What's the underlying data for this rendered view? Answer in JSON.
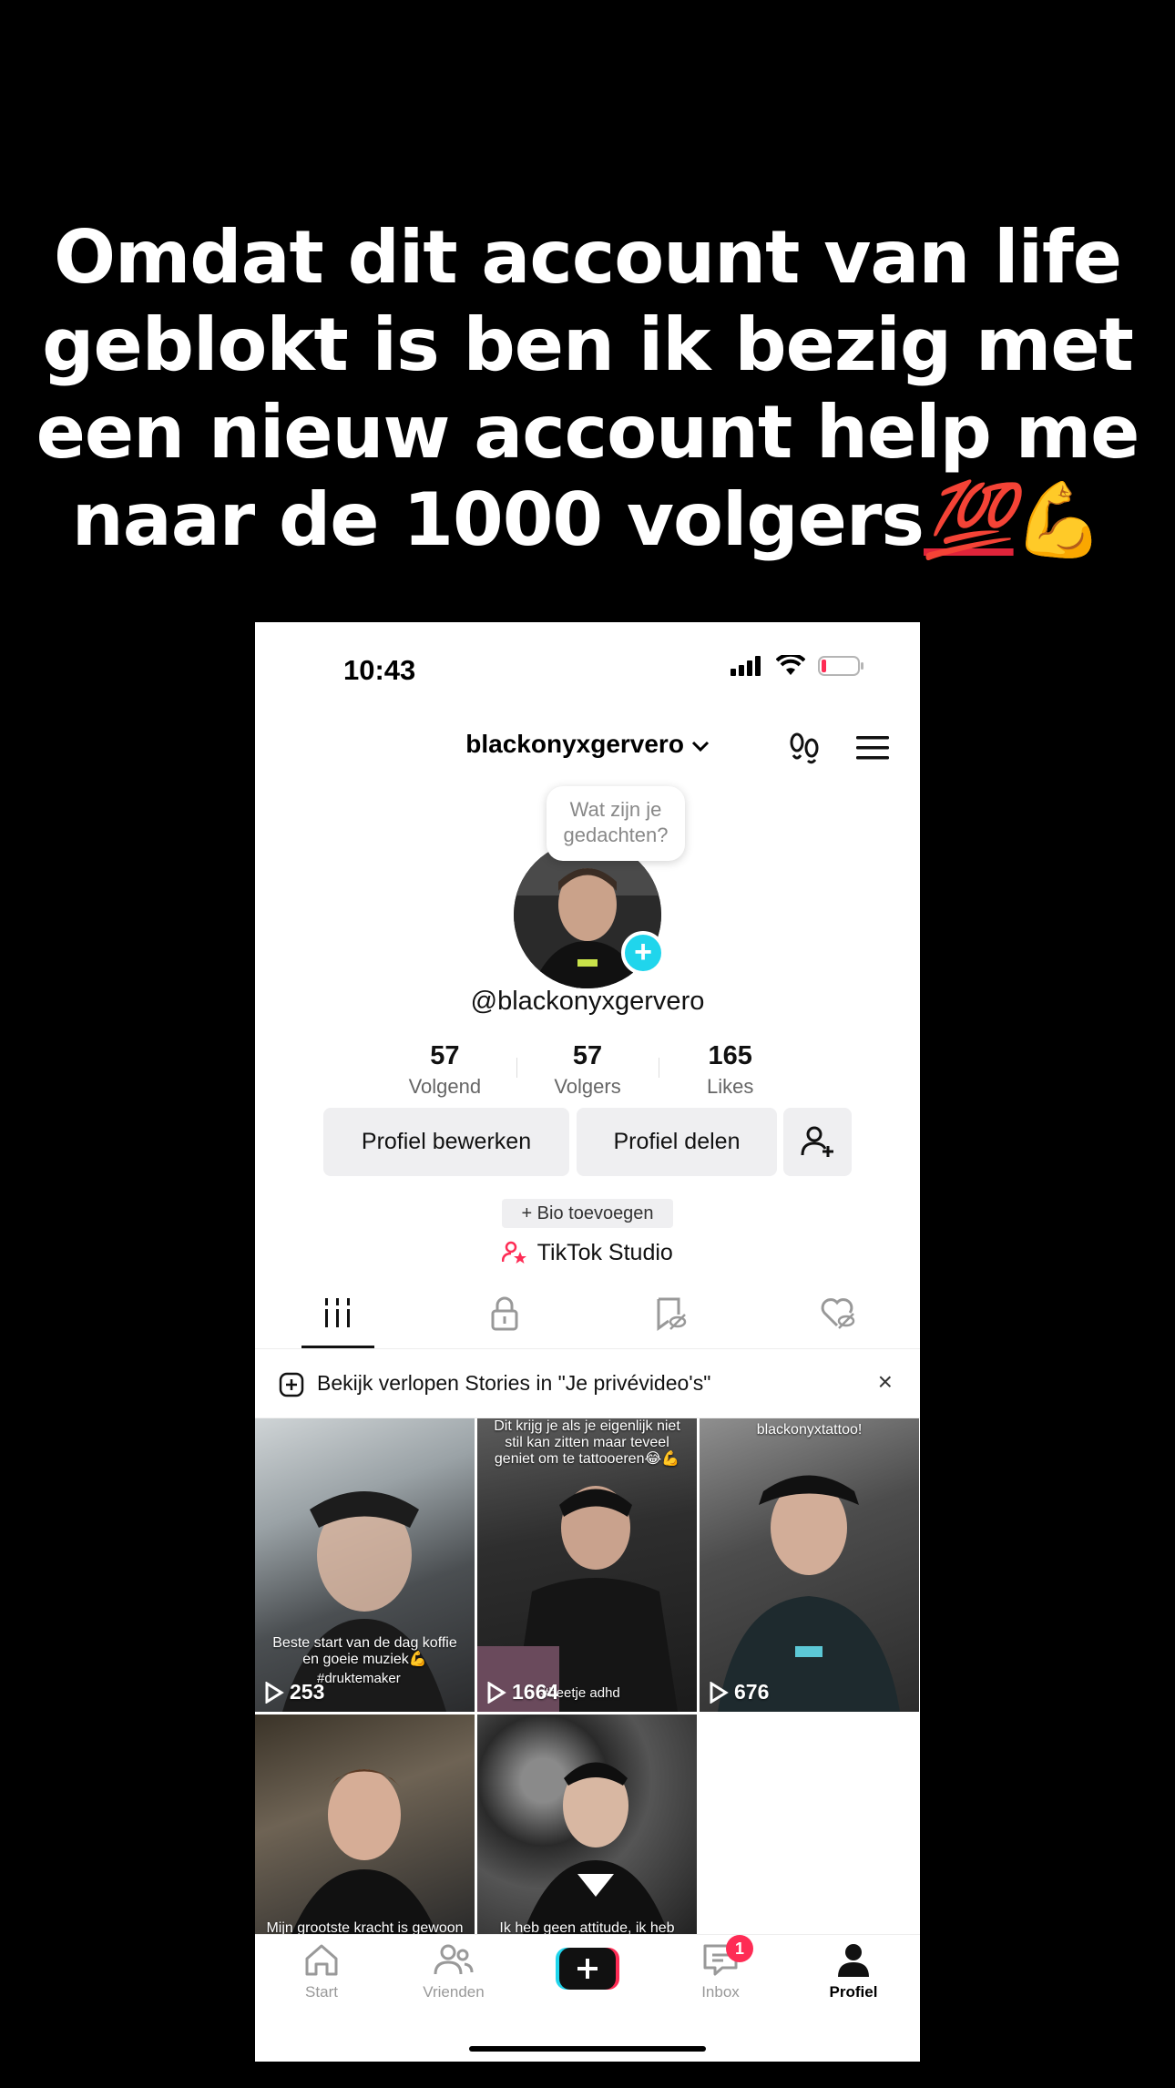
{
  "caption": {
    "lines": [
      "Omdat dit account van life",
      "geblokt is ben ik bezig met",
      "een nieuw account help me",
      "naar de 1000 volgers"
    ],
    "emoji_100": "💯",
    "emoji_flex": "💪"
  },
  "status_bar": {
    "time": "10:43",
    "battery_level": 0.1
  },
  "header": {
    "username": "blackonyxgervero",
    "icons": [
      "footprints-icon",
      "menu-icon"
    ]
  },
  "thought_bubble": {
    "line1": "Wat zijn je",
    "line2": "gedachten?"
  },
  "profile": {
    "handle": "@blackonyxgervero"
  },
  "stats": [
    {
      "value": "57",
      "label": "Volgend"
    },
    {
      "value": "57",
      "label": "Volgers"
    },
    {
      "value": "165",
      "label": "Likes"
    }
  ],
  "buttons": {
    "edit": "Profiel bewerken",
    "share": "Profiel delen"
  },
  "bio_button": "+ Bio toevoegen",
  "studio_link": "TikTok Studio",
  "banner": {
    "text": "Bekijk verlopen Stories in \"Je privévideo's\"",
    "close": "×"
  },
  "videos": [
    {
      "views": "253",
      "caption": "Beste start van de dag koffie en goeie muziek💪",
      "tag": "#druktemaker"
    },
    {
      "views": "1664",
      "caption": "Dit krijg je als je eigenlijk niet stil kan zitten maar teveel geniet om te tattooeren😂💪",
      "tag": "#beetje adhd"
    },
    {
      "views": "676",
      "caption": "blackonyxtattoo!",
      "tag": ""
    },
    {
      "views": "",
      "caption": "Mijn grootste kracht is gewoon dit",
      "tag": ""
    },
    {
      "views": "",
      "caption": "Ik heb geen attitude, ik heb",
      "tag": ""
    }
  ],
  "nav": {
    "start": "Start",
    "friends": "Vrienden",
    "inbox": "Inbox",
    "inbox_badge": "1",
    "profile": "Profiel"
  },
  "colors": {
    "accent_pink": "#fe2c55",
    "accent_cyan": "#20d5ec"
  }
}
